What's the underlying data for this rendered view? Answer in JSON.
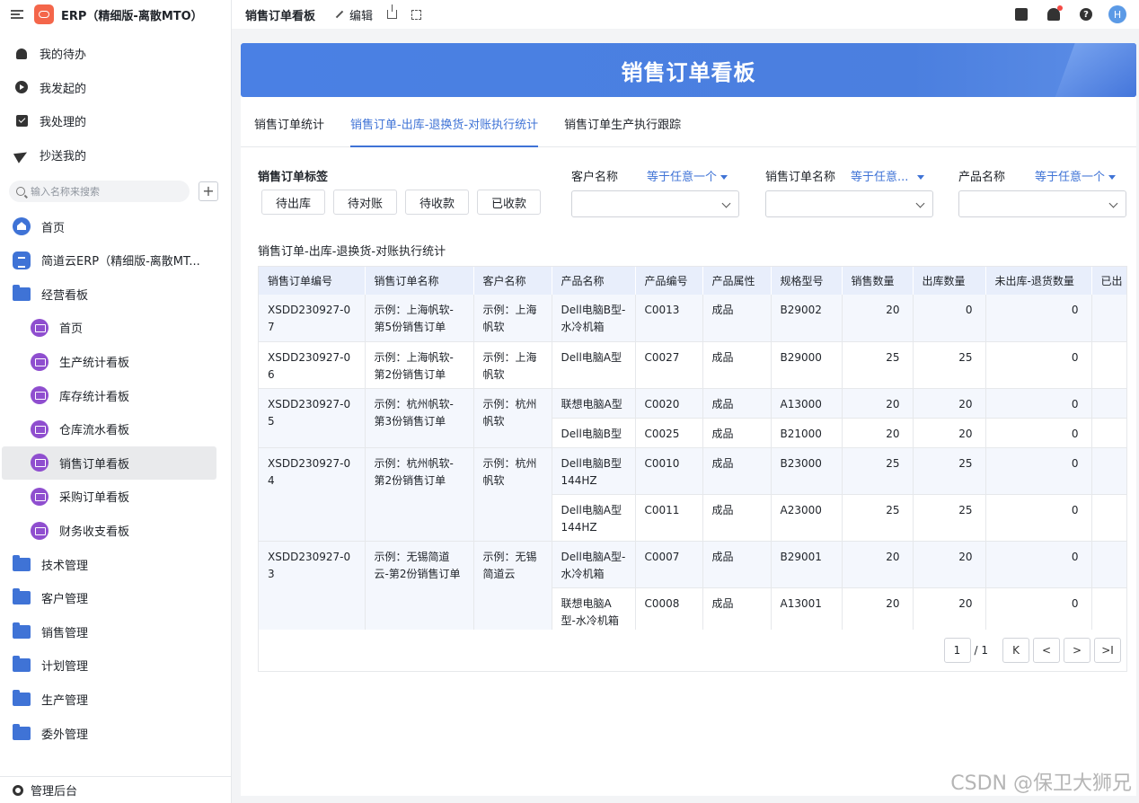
{
  "app": {
    "title": "ERP（精细版-离散MTO）"
  },
  "nav_top": [
    {
      "label": "我的待办",
      "icon": "bell-icon"
    },
    {
      "label": "我发起的",
      "icon": "play-icon"
    },
    {
      "label": "我处理的",
      "icon": "check-icon"
    },
    {
      "label": "抄送我的",
      "icon": "send-icon"
    }
  ],
  "search": {
    "placeholder": "输入名称来搜索",
    "add": "+"
  },
  "tree": [
    {
      "label": "首页",
      "icon": "home-icon"
    },
    {
      "label": "简道云ERP（精细版-离散MT...",
      "icon": "doc-icon"
    },
    {
      "label": "经营看板",
      "icon": "folder-icon"
    },
    {
      "label": "首页",
      "icon": "dashboard-icon"
    },
    {
      "label": "生产统计看板",
      "icon": "dashboard-icon"
    },
    {
      "label": "库存统计看板",
      "icon": "dashboard-icon"
    },
    {
      "label": "仓库流水看板",
      "icon": "dashboard-icon"
    },
    {
      "label": "销售订单看板",
      "icon": "dashboard-icon",
      "active": true
    },
    {
      "label": "采购订单看板",
      "icon": "dashboard-icon"
    },
    {
      "label": "财务收支看板",
      "icon": "dashboard-icon"
    },
    {
      "label": "技术管理",
      "icon": "folder-icon"
    },
    {
      "label": "客户管理",
      "icon": "folder-icon"
    },
    {
      "label": "销售管理",
      "icon": "folder-icon"
    },
    {
      "label": "计划管理",
      "icon": "folder-icon"
    },
    {
      "label": "生产管理",
      "icon": "folder-icon"
    },
    {
      "label": "委外管理",
      "icon": "folder-icon"
    }
  ],
  "sidebar_footer": "管理后台",
  "topbar": {
    "title": "销售订单看板",
    "edit": "编辑",
    "avatar": "H",
    "help": "?"
  },
  "banner": {
    "title": "销售订单看板"
  },
  "tabs": [
    {
      "label": "销售订单统计"
    },
    {
      "label": "销售订单-出库-退换货-对账执行统计",
      "active": true
    },
    {
      "label": "销售订单生产执行跟踪"
    }
  ],
  "filters": {
    "tag_label": "销售订单标签",
    "tags": [
      "待出库",
      "待对账",
      "待收款",
      "已收款"
    ],
    "customer_label": "客户名称",
    "customer_op": "等于任意一个",
    "order_label": "销售订单名称",
    "order_op": "等于任意...",
    "product_label": "产品名称",
    "product_op": "等于任意一个"
  },
  "section_title": "销售订单-出库-退换货-对账执行统计",
  "table": {
    "headers": [
      "销售订单编号",
      "销售订单名称",
      "客户名称",
      "产品名称",
      "产品编号",
      "产品属性",
      "规格型号",
      "销售数量",
      "出库数量",
      "未出库-退货数量",
      "已出"
    ],
    "groups": [
      {
        "code": "XSDD230927-07",
        "name": "示例：上海帆软-第5份销售订单",
        "customer": "示例：上海帆软",
        "rows": [
          {
            "product": "Dell电脑B型-水冷机箱",
            "pcode": "C0013",
            "attr": "成品",
            "spec": "B29002",
            "qty": "20",
            "out": "0",
            "unout": "0"
          }
        ]
      },
      {
        "code": "XSDD230927-06",
        "name": "示例：上海帆软-第2份销售订单",
        "customer": "示例：上海帆软",
        "rows": [
          {
            "product": "Dell电脑A型",
            "pcode": "C0027",
            "attr": "成品",
            "spec": "B29000",
            "qty": "25",
            "out": "25",
            "unout": "0"
          }
        ]
      },
      {
        "code": "XSDD230927-05",
        "name": "示例：杭州帆软-第3份销售订单",
        "customer": "示例：杭州帆软",
        "rows": [
          {
            "product": "联想电脑A型",
            "pcode": "C0020",
            "attr": "成品",
            "spec": "A13000",
            "qty": "20",
            "out": "20",
            "unout": "0"
          },
          {
            "product": "Dell电脑B型",
            "pcode": "C0025",
            "attr": "成品",
            "spec": "B21000",
            "qty": "20",
            "out": "20",
            "unout": "0"
          }
        ]
      },
      {
        "code": "XSDD230927-04",
        "name": "示例：杭州帆软-第2份销售订单",
        "customer": "示例：杭州帆软",
        "rows": [
          {
            "product": "Dell电脑B型144HZ",
            "pcode": "C0010",
            "attr": "成品",
            "spec": "B23000",
            "qty": "25",
            "out": "25",
            "unout": "0"
          },
          {
            "product": "Dell电脑A型144HZ",
            "pcode": "C0011",
            "attr": "成品",
            "spec": "A23000",
            "qty": "25",
            "out": "25",
            "unout": "0"
          }
        ]
      },
      {
        "code": "XSDD230927-03",
        "name": "示例：无锡简道云-第2份销售订单",
        "customer": "示例：无锡简道云",
        "rows": [
          {
            "product": "Dell电脑A型-水冷机箱",
            "pcode": "C0007",
            "attr": "成品",
            "spec": "B29001",
            "qty": "20",
            "out": "20",
            "unout": "0"
          },
          {
            "product": "联想电脑A型-水冷机箱",
            "pcode": "C0008",
            "attr": "成品",
            "spec": "A13001",
            "qty": "20",
            "out": "20",
            "unout": "0"
          }
        ]
      }
    ]
  },
  "pagination": {
    "current": "1",
    "total": "/ 1",
    "first": "K",
    "prev": "<",
    "next": ">",
    "last": ">I"
  },
  "watermark": "CSDN @保卫大狮兄"
}
